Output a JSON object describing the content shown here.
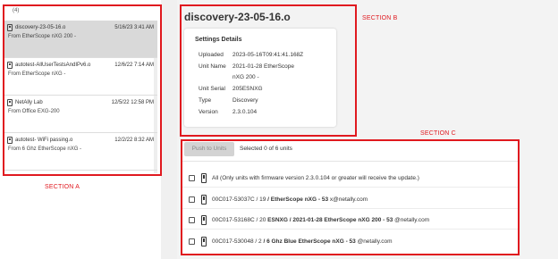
{
  "file_list": {
    "count_label": "(4)",
    "items": [
      {
        "name": "discovery-23-05-16.o",
        "date": "5/16/23 3:41 AM",
        "from": "From  EtherScope nXG 200 -",
        "selected": true
      },
      {
        "name": "autotest-AllUserTestsAndIPv6.o",
        "date": "12/6/22 7:14 AM",
        "from": "From  EtherScope nXG -",
        "selected": false
      },
      {
        "name": "NetAlly Lab",
        "date": "12/5/22 12:58 PM",
        "from": "From  Office EXG-200",
        "selected": false
      },
      {
        "name": "autotest- WiFi passing.o",
        "date": "12/2/22 8:32 AM",
        "from": "From  6 Ghz EtherScope nXG -",
        "selected": false
      }
    ]
  },
  "details": {
    "title": "discovery-23-05-16.o",
    "card_heading": "Settings Details",
    "fields": [
      {
        "label": "Uploaded",
        "value": "2023-05-16T09:41:41.168Z"
      },
      {
        "label": "Unit Name",
        "value": "2021-01-28 EtherScope"
      },
      {
        "label": "",
        "value": "nXG 200 -"
      },
      {
        "label": "Unit Serial",
        "value": "205ESNXG"
      },
      {
        "label": "Type",
        "value": "Discovery"
      },
      {
        "label": "Version",
        "value": "2.3.0.104"
      }
    ]
  },
  "units": {
    "push_label": "Push to Units",
    "selected_text": "Selected 0 of 6 units",
    "all_label": "All (Only units with firmware version 2.3.0.104 or greater will receive the update.)",
    "rows": [
      {
        "prefix": "00C017-53037C / 19",
        "bold": "/ EtherScope nXG - 53",
        "suffix": "x@netally.com"
      },
      {
        "prefix": "00C017-53168C / 20",
        "bold": "ESNXG / 2021-01-28 EtherScope nXG 200 - 53",
        "suffix": "@netally.com"
      },
      {
        "prefix": "00C017-530048 / 2",
        "bold": "/ 6 Ghz Blue EtherScope nXG - 53",
        "suffix": "@netally.com"
      }
    ]
  },
  "sections": {
    "a": "SECTION A",
    "b": "SECTION B",
    "c": "SECTION C"
  },
  "colors": {
    "section_outline": "#e0191f",
    "selected_row": "#d9d9d9"
  }
}
